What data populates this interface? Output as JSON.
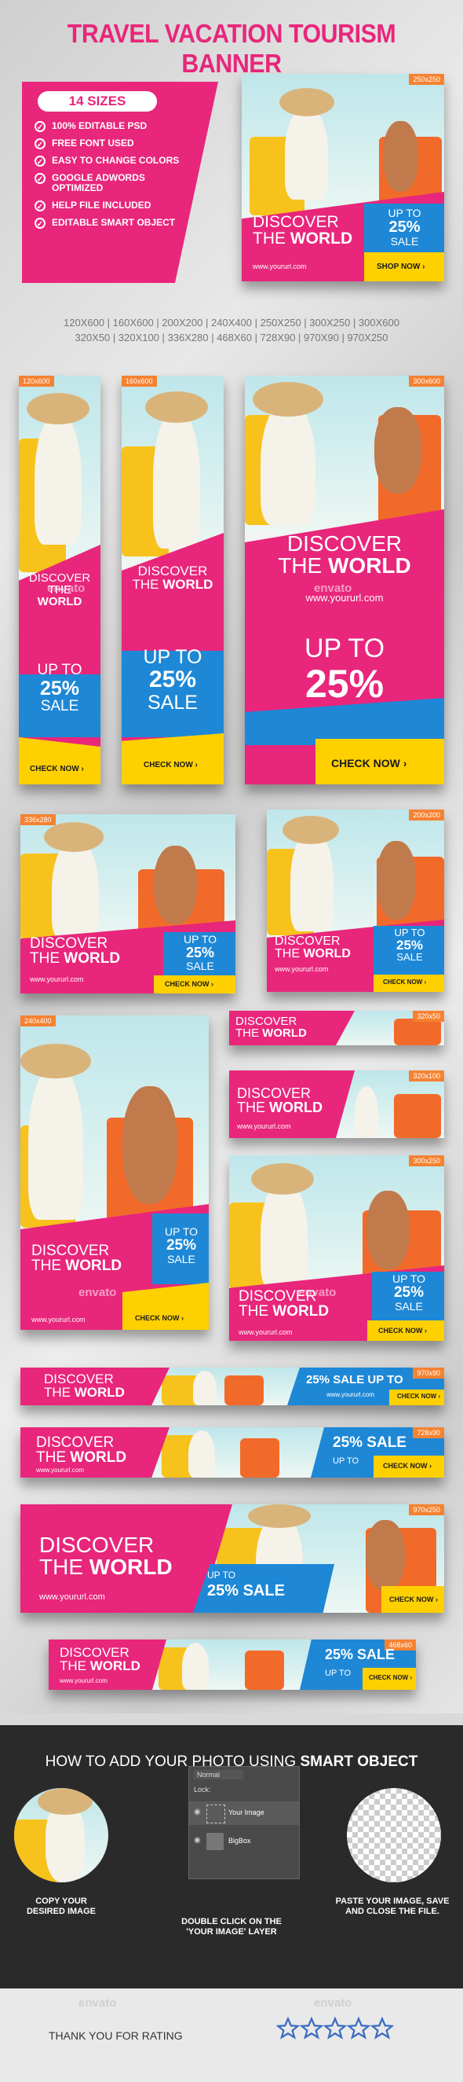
{
  "title": "TRAVEL VACATION TOURISM BANNER",
  "features": {
    "badge": "14 SIZES",
    "items": [
      "100% EDITABLE PSD",
      "FREE FONT USED",
      "EASY TO CHANGE COLORS",
      "GOOGLE ADWORDS OPTIMIZED",
      "HELP FILE INCLUDED",
      "EDITABLE SMART OBJECT"
    ]
  },
  "size_list": {
    "row1": "120X600 | 160X600 | 200X200 | 240X400 | 250X250 | 300X250 | 300X600",
    "row2": "320X50 | 320X100 | 336X280 | 468X60 | 728X90 | 970X90 | 970X250"
  },
  "banner_copy": {
    "discover": "DISCOVER",
    "the": "THE",
    "world": "WORLD",
    "url": "www.yoururl.com",
    "up_to": "UP TO",
    "percent": "25%",
    "sale": "SALE",
    "sale_full": "25% SALE",
    "sale_upto": "25% SALE UP TO",
    "check_now": "CHECK NOW ›",
    "shop_now": "SHOP NOW ›"
  },
  "banners": {
    "b250": "250x250",
    "b120": "120x600",
    "b160": "160x600",
    "b300x600": "300x600",
    "b336": "336x280",
    "b200": "200x200",
    "b240": "240x400",
    "b320x50": "320x50",
    "b320x100": "320x100",
    "b300x250": "300x250",
    "b970x90": "970x90",
    "b728": "728x90",
    "b970x250": "970x250",
    "b468": "468x60"
  },
  "watermark": "envato",
  "howto": {
    "heading_prefix": "HOW TO ADD YOUR PHOTO USING ",
    "heading_bold": "SMART OBJECT",
    "step1": "COPY YOUR DESIRED IMAGE",
    "step2": "DOUBLE CLICK ON THE 'YOUR IMAGE' LAYER",
    "step3": "PASTE YOUR IMAGE, SAVE AND CLOSE THE FILE.",
    "layers_mode": "Normal",
    "layers_lock": "Lock:",
    "layer1": "Your Image",
    "layer2": "BigBox"
  },
  "footer": {
    "thanks": "THANK YOU FOR RATING",
    "stars": 5
  },
  "colors": {
    "pink": "#e8267b",
    "blue": "#1e88d6",
    "yellow": "#ffd000",
    "orange": "#f58231"
  }
}
